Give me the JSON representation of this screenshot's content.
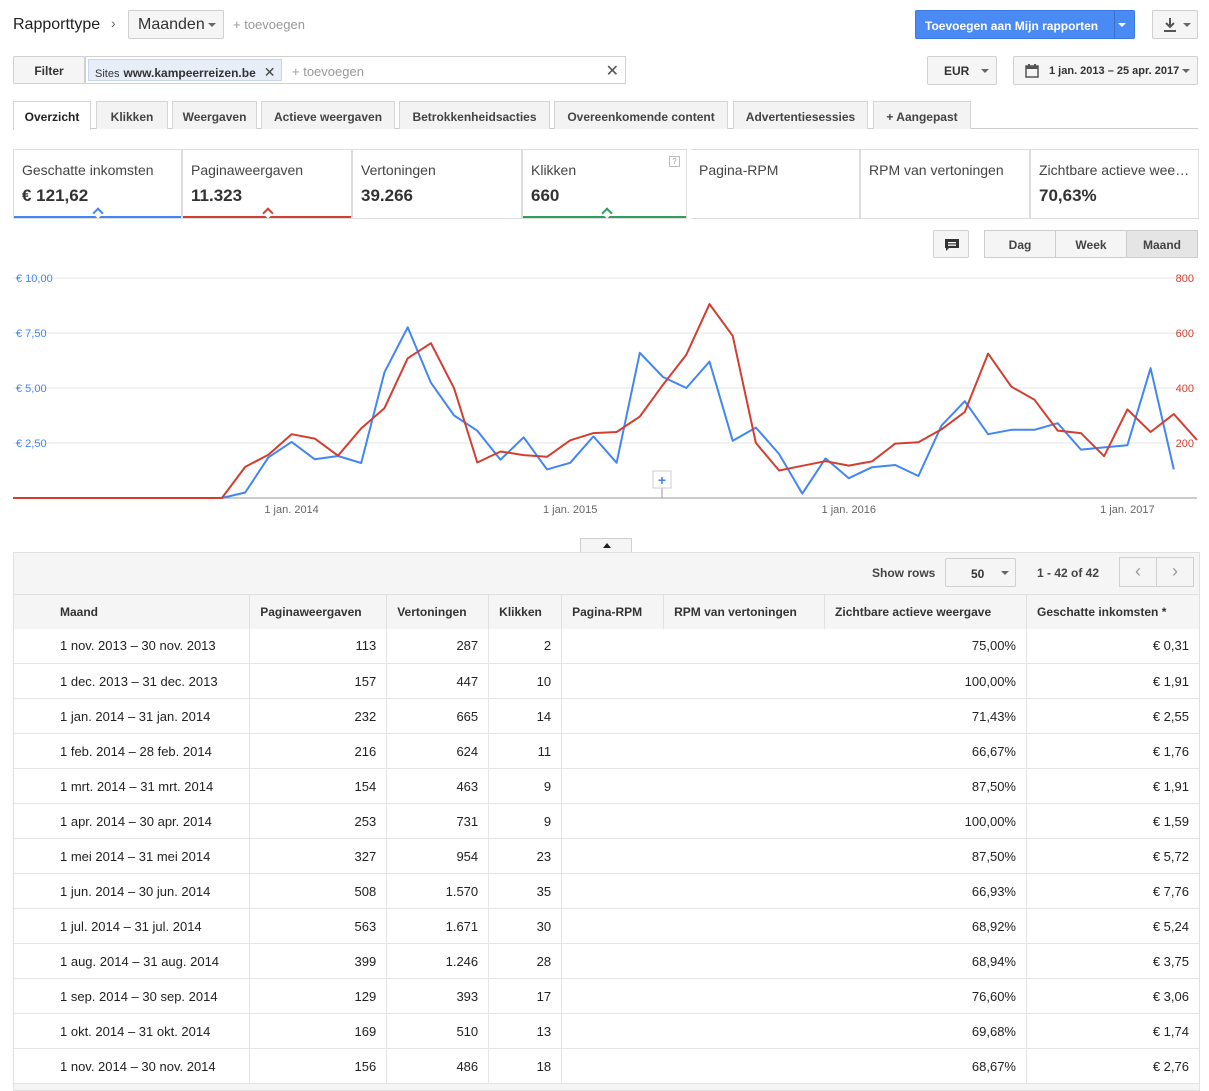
{
  "header": {
    "report_type_label": "Rapporttype",
    "granularity": "Maanden",
    "add_dimension": "+ toevoegen",
    "add_to_reports": "Toevoegen aan Mijn rapporten"
  },
  "filter": {
    "label": "Filter",
    "chip_prefix": "Sites",
    "chip_value": "www.kampeerreizen.be",
    "add_placeholder": "+ toevoegen"
  },
  "currency": "EUR",
  "date_range": "1 jan. 2013 – 25 apr. 2017",
  "tabs": [
    "Overzicht",
    "Klikken",
    "Weergaven",
    "Actieve weergaven",
    "Betrokkenheidsacties",
    "Overeenkomende content",
    "Advertentiesessies",
    "+ Aangepast"
  ],
  "scorecards": [
    {
      "title": "Geschatte inkomsten",
      "value": "€ 121,62",
      "color": "#4285f4"
    },
    {
      "title": "Paginaweergaven",
      "value": "11.323",
      "color": "#d23f31"
    },
    {
      "title": "Vertoningen",
      "value": "39.266",
      "color": ""
    },
    {
      "title": "Klikken",
      "value": "660",
      "color": "#2e9e5b",
      "help": "?"
    },
    {
      "title": "Pagina-RPM",
      "value": "",
      "color": ""
    },
    {
      "title": "RPM van vertoningen",
      "value": "",
      "color": ""
    },
    {
      "title": "Zichtbare actieve weergave",
      "value": "70,63%",
      "color": ""
    }
  ],
  "chart_controls": {
    "day": "Dag",
    "week": "Week",
    "month": "Maand"
  },
  "chart_data": {
    "type": "line",
    "left_axis": {
      "ticks": [
        "€ 10,00",
        "€ 7,50",
        "€ 5,00",
        "€ 2,50"
      ],
      "ylim": [
        0,
        10
      ]
    },
    "right_axis": {
      "ticks": [
        "800",
        "600",
        "400",
        "200"
      ],
      "ylim": [
        0,
        800
      ]
    },
    "x_ticks": [
      "1 jan. 2014",
      "1 jan. 2015",
      "1 jan. 2016",
      "1 jan. 2017"
    ],
    "x_months": 52,
    "series": [
      {
        "color": "#4285f4",
        "axis": "left",
        "values": [
          0,
          0,
          0,
          0,
          0,
          0,
          0,
          0,
          0,
          0,
          0.25,
          1.85,
          2.55,
          1.76,
          1.91,
          1.59,
          5.72,
          7.76,
          5.24,
          3.75,
          3.06,
          1.74,
          2.76,
          1.3,
          1.6,
          2.8,
          1.6,
          6.6,
          5.5,
          5.0,
          6.2,
          2.6,
          3.2,
          2.0,
          0.2,
          1.8,
          0.9,
          1.4,
          1.5,
          1.0,
          3.3,
          4.4,
          2.9,
          3.1,
          3.1,
          3.4,
          2.2,
          2.3,
          2.4,
          5.9,
          1.3
        ]
      },
      {
        "color": "#d23f31",
        "axis": "right",
        "values": [
          0,
          0,
          0,
          0,
          0,
          0,
          0,
          0,
          0,
          0,
          113,
          157,
          232,
          216,
          154,
          253,
          327,
          508,
          563,
          399,
          129,
          169,
          156,
          150,
          210,
          236,
          240,
          296,
          412,
          521,
          705,
          590,
          200,
          100,
          117,
          134,
          118,
          133,
          198,
          203,
          250,
          313,
          525,
          405,
          357,
          245,
          236,
          152,
          322,
          240,
          305,
          211
        ]
      }
    ]
  },
  "table": {
    "show_rows_label": "Show rows",
    "rows_per_page": "50",
    "range": "1 - 42 of 42",
    "columns": [
      "Maand",
      "Paginaweergaven",
      "Vertoningen",
      "Klikken",
      "Pagina-RPM",
      "RPM van vertoningen",
      "Zichtbare actieve weergave",
      "Geschatte inkomsten *"
    ],
    "rows": [
      [
        "1 nov. 2013 – 30 nov. 2013",
        "113",
        "287",
        "2",
        "",
        "",
        "75,00%",
        "€ 0,31"
      ],
      [
        "1 dec. 2013 – 31 dec. 2013",
        "157",
        "447",
        "10",
        "",
        "",
        "100,00%",
        "€ 1,91"
      ],
      [
        "1 jan. 2014 – 31 jan. 2014",
        "232",
        "665",
        "14",
        "",
        "",
        "71,43%",
        "€ 2,55"
      ],
      [
        "1 feb. 2014 – 28 feb. 2014",
        "216",
        "624",
        "11",
        "",
        "",
        "66,67%",
        "€ 1,76"
      ],
      [
        "1 mrt. 2014 – 31 mrt. 2014",
        "154",
        "463",
        "9",
        "",
        "",
        "87,50%",
        "€ 1,91"
      ],
      [
        "1 apr. 2014 – 30 apr. 2014",
        "253",
        "731",
        "9",
        "",
        "",
        "100,00%",
        "€ 1,59"
      ],
      [
        "1 mei 2014 – 31 mei 2014",
        "327",
        "954",
        "23",
        "",
        "",
        "87,50%",
        "€ 5,72"
      ],
      [
        "1 jun. 2014 – 30 jun. 2014",
        "508",
        "1.570",
        "35",
        "",
        "",
        "66,93%",
        "€ 7,76"
      ],
      [
        "1 jul. 2014 – 31 jul. 2014",
        "563",
        "1.671",
        "30",
        "",
        "",
        "68,92%",
        "€ 5,24"
      ],
      [
        "1 aug. 2014 – 31 aug. 2014",
        "399",
        "1.246",
        "28",
        "",
        "",
        "68,94%",
        "€ 3,75"
      ],
      [
        "1 sep. 2014 – 30 sep. 2014",
        "129",
        "393",
        "17",
        "",
        "",
        "76,60%",
        "€ 3,06"
      ],
      [
        "1 okt. 2014 – 31 okt. 2014",
        "169",
        "510",
        "13",
        "",
        "",
        "69,68%",
        "€ 1,74"
      ],
      [
        "1 nov. 2014 – 30 nov. 2014",
        "156",
        "486",
        "18",
        "",
        "",
        "68,67%",
        "€ 2,76"
      ]
    ]
  }
}
